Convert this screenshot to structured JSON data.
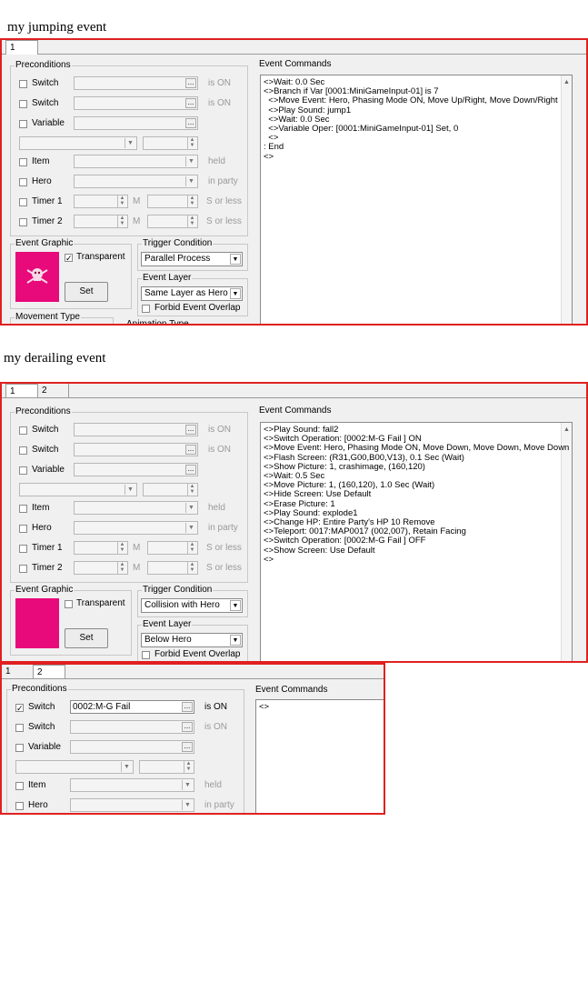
{
  "titles": {
    "jumping": "my jumping event",
    "derailing": "my derailing event"
  },
  "common": {
    "preconditions": "Preconditions",
    "event_commands": "Event Commands",
    "switch": "Switch",
    "variable": "Variable",
    "item": "Item",
    "hero": "Hero",
    "timer1": "Timer 1",
    "timer2": "Timer 2",
    "is_on": "is ON",
    "held": "held",
    "in_party": "in party",
    "m": "M",
    "s_or_less": "S or less",
    "event_graphic": "Event Graphic",
    "transparent": "Transparent",
    "set": "Set",
    "trigger_condition": "Trigger Condition",
    "event_layer": "Event Layer",
    "forbid_overlap": "Forbid Event Overlap",
    "movement_type": "Movement Type",
    "animation_type": "Animation Type",
    "dots": "...",
    "check": "✓"
  },
  "jumping": {
    "tabs": [
      "1"
    ],
    "trigger": "Parallel Process",
    "layer": "Same Layer as Hero",
    "commands": [
      "<>Wait: 0.0 Sec",
      "<>Branch if Var [0001:MiniGameInput-01] is 7",
      "  <>Move Event: Hero, Phasing Mode ON, Move Up/Right, Move Down/Right",
      "  <>Play Sound: jump1",
      "  <>Wait: 0.0 Sec",
      "  <>Variable Oper: [0001:MiniGameInput-01] Set, 0",
      "  <>",
      ": End",
      "<>"
    ]
  },
  "derailing": {
    "tabs": [
      "1",
      "2"
    ],
    "trigger": "Collision with Hero",
    "layer": "Below Hero",
    "commands": [
      "<>Play Sound: fall2",
      "<>Switch Operation: [0002:M-G Fail ] ON",
      "<>Move Event: Hero, Phasing Mode ON, Move Down, Move Down, Move Down",
      "<>Flash Screen: (R31,G00,B00,V13), 0.1 Sec (Wait)",
      "<>Show Picture: 1, crashimage, (160,120)",
      "<>Wait: 0.5 Sec",
      "<>Move Picture: 1, (160,120), 1.0 Sec (Wait)",
      "<>Hide Screen: Use Default",
      "<>Erase Picture: 1",
      "<>Play Sound: explode1",
      "<>Change HP: Entire Party's HP 10 Remove",
      "<>Teleport: 0017:MAP0017 (002,007), Retain Facing",
      "<>Switch Operation: [0002:M-G Fail ] OFF",
      "<>Show Screen: Use Default",
      "<>"
    ]
  },
  "page2": {
    "tabs": [
      "1",
      "2"
    ],
    "switch_value": "0002:M-G Fail",
    "commands": [
      "<>"
    ]
  }
}
